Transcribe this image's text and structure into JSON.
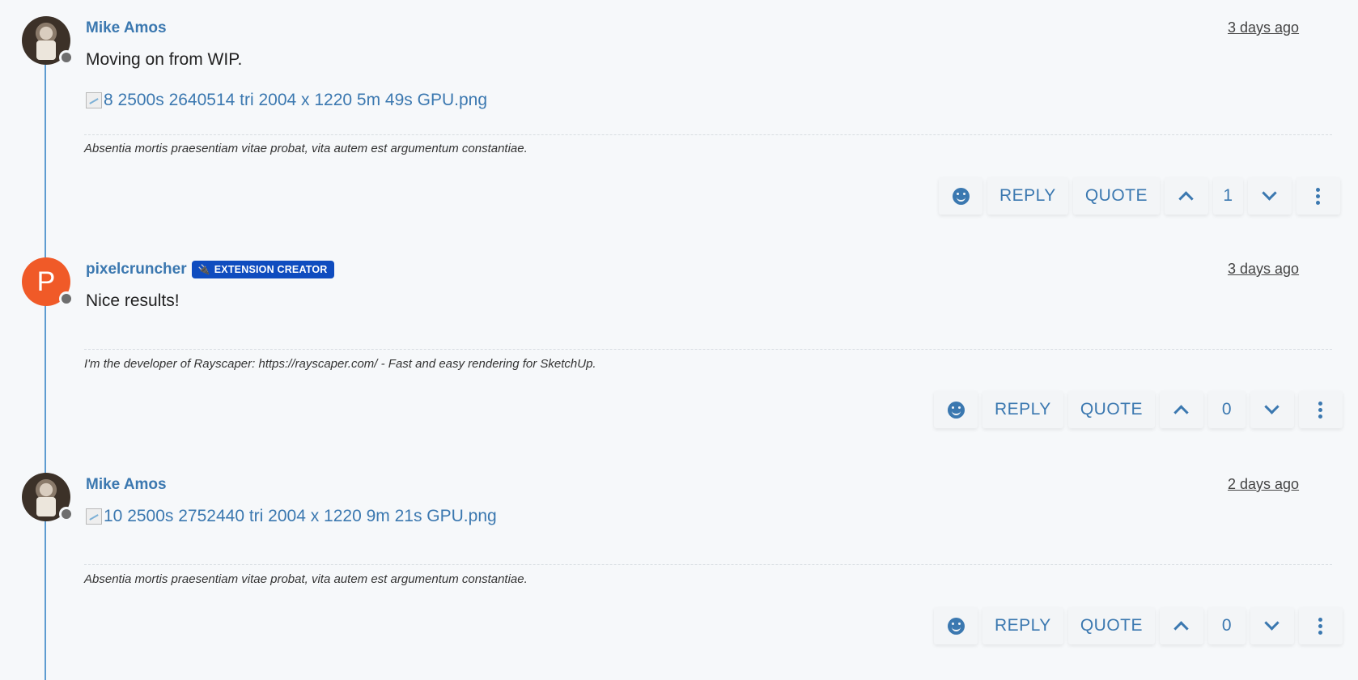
{
  "posts": [
    {
      "author": "Mike Amos",
      "badge": "",
      "time": "3 days ago",
      "content": "Moving on from WIP.",
      "image_alt": "8 2500s 2640514 tri 2004 x 1220 5m 49s GPU.png",
      "signature": "Absentia mortis praesentiam vitae probat, vita autem est argumentum constantiae.",
      "actions": {
        "reply": "REPLY",
        "quote": "QUOTE",
        "votes": "1"
      }
    },
    {
      "author": "pixelcruncher",
      "avatar_letter": "P",
      "badge": "EXTENSION CREATOR",
      "time": "3 days ago",
      "content": "Nice results!",
      "signature": "I'm the developer of Rayscaper: https://rayscaper.com/ - Fast and easy rendering for SketchUp.",
      "actions": {
        "reply": "REPLY",
        "quote": "QUOTE",
        "votes": "0"
      }
    },
    {
      "author": "Mike Amos",
      "time": "2 days ago",
      "image_alt": "10 2500s 2752440 tri 2004 x 1220 9m 21s GPU.png",
      "signature": "Absentia mortis praesentiam vitae probat, vita autem est argumentum constantiae.",
      "actions": {
        "reply": "REPLY",
        "quote": "QUOTE",
        "votes": "0"
      }
    }
  ],
  "colors": {
    "accent": "#3b78b0",
    "badge": "#0f4cbf",
    "avatar_orange": "#f05a28",
    "timeline": "#5e9cd0"
  },
  "icons": [
    "smiley-icon",
    "chevron-up-icon",
    "chevron-down-icon",
    "more-vertical-icon",
    "plug-icon"
  ]
}
